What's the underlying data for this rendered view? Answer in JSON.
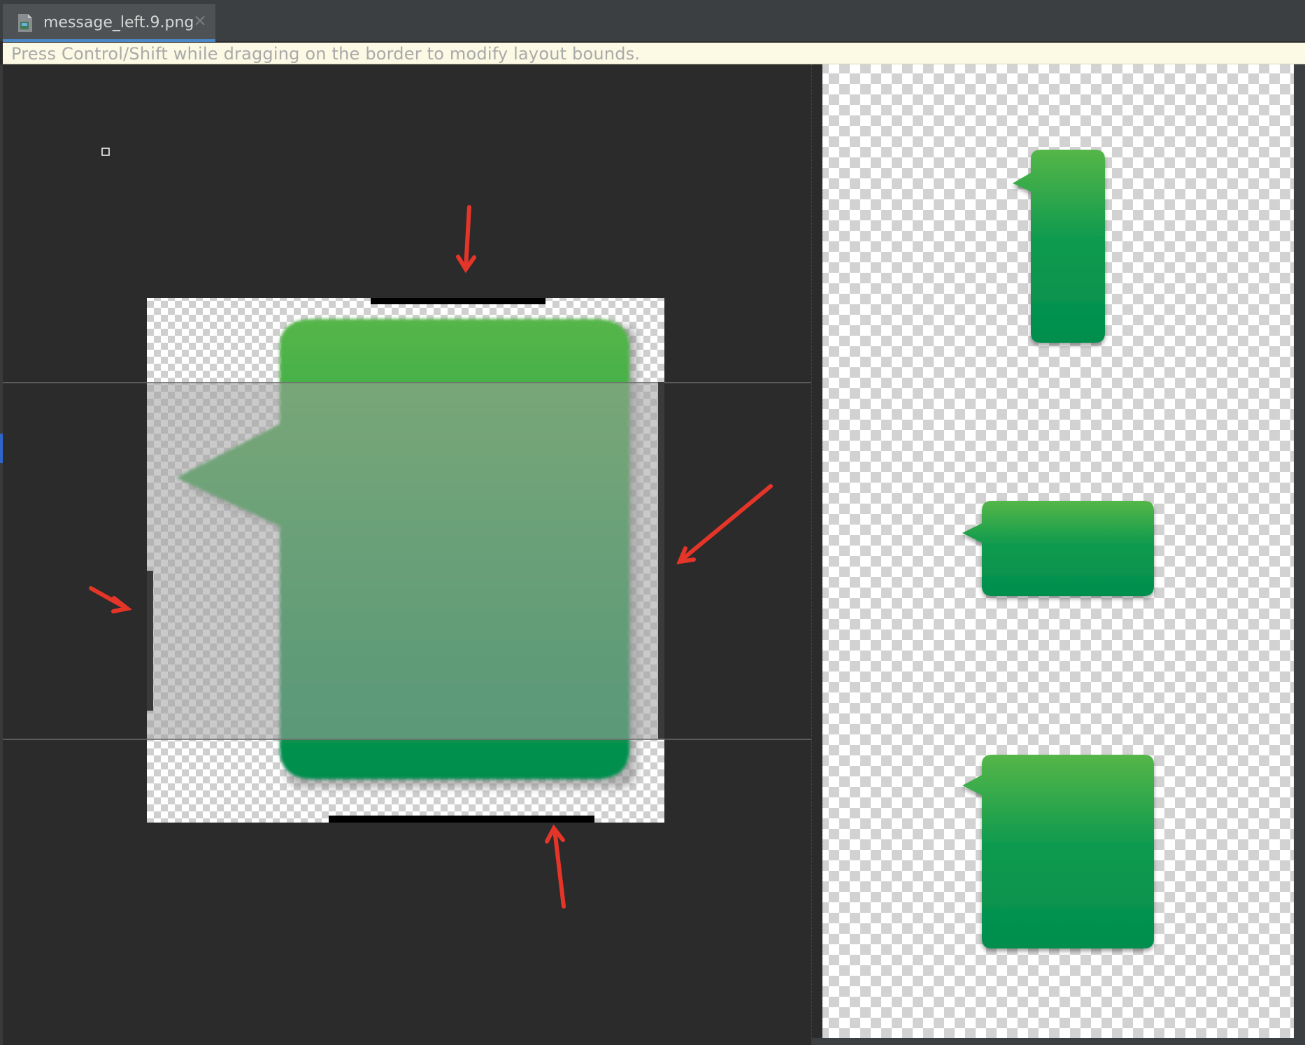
{
  "tab": {
    "file_name": "message_left.9.png",
    "close_glyph": "×",
    "icon": "image-file-icon"
  },
  "hint": {
    "text": "Press Control/Shift while dragging on the border to modify layout bounds."
  },
  "colors": {
    "bubble_top": "#52b347",
    "bubble_bottom": "#008e4e",
    "content_overlay": "#9e9e9e",
    "guide_line": "#6a6a6a",
    "patch_marker": "#000000",
    "annotation_arrow": "#e53529",
    "tab_underline": "#4a88c7",
    "hint_background": "#fcfae4"
  },
  "annotations": {
    "arrow_count": 4,
    "icon": "red-arrow-icon"
  },
  "preview": {
    "samples": [
      "tall",
      "wide",
      "square"
    ]
  }
}
